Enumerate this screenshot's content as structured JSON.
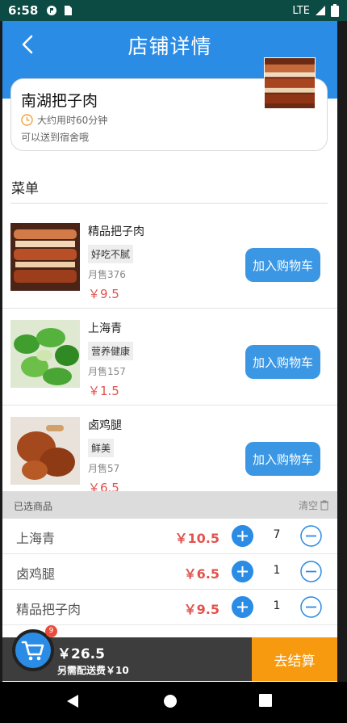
{
  "status_bar": {
    "time": "6:58",
    "network": "LTE"
  },
  "app_bar": {
    "title": "店铺详情"
  },
  "shop": {
    "name": "南湖把子肉",
    "time_estimate": "大约用时60分钟",
    "note": "可以送到宿舍哦"
  },
  "menu": {
    "title": "菜单",
    "items": [
      {
        "name": "精品把子肉",
        "tag": "好吃不腻",
        "sales": "月售376",
        "price": "￥9.5",
        "button": "加入购物车"
      },
      {
        "name": "上海青",
        "tag": "营养健康",
        "sales": "月售157",
        "price": "￥1.5",
        "button": "加入购物车"
      },
      {
        "name": "卤鸡腿",
        "tag": "鲜美",
        "sales": "月售57",
        "price": "￥6.5",
        "button": "加入购物车"
      }
    ]
  },
  "cart": {
    "header": "已选商品",
    "clear": "清空",
    "items": [
      {
        "name": "上海青",
        "price": "￥10.5",
        "qty": "7"
      },
      {
        "name": "卤鸡腿",
        "price": "￥6.5",
        "qty": "1"
      },
      {
        "name": "精品把子肉",
        "price": "￥9.5",
        "qty": "1"
      }
    ],
    "badge": "9",
    "total": "￥26.5",
    "delivery_fee": "另需配送费￥10",
    "checkout": "去结算"
  },
  "colors": {
    "primary": "#2b8ce6",
    "price": "#e2534e",
    "checkout": "#f79a0f",
    "bar": "#3d3d3d"
  },
  "icons": [
    "back-arrow-icon",
    "clock-icon",
    "trash-icon",
    "plus-icon",
    "minus-icon",
    "cart-icon",
    "nav-back-icon",
    "nav-home-icon",
    "nav-recents-icon"
  ]
}
